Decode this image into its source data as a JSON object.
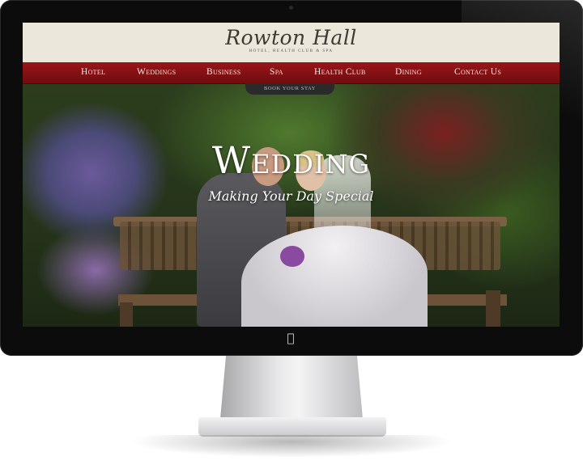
{
  "site": {
    "logo": "Rowton Hall",
    "tagline": "Hotel, Health Club & Spa"
  },
  "nav": {
    "items": [
      {
        "label": "Hotel"
      },
      {
        "label": "Weddings"
      },
      {
        "label": "Business"
      },
      {
        "label": "Spa"
      },
      {
        "label": "Health Club"
      },
      {
        "label": "Dining"
      },
      {
        "label": "Contact Us"
      }
    ],
    "book_label": "Book your stay"
  },
  "hero": {
    "title": "Wedding",
    "subtitle": "Making Your Day Special"
  },
  "colors": {
    "nav_red": "#8a1114",
    "header_cream": "#ebe7da",
    "bezel": "#0c0c0c"
  },
  "icons": {
    "monitor_logo": "apple-logo-icon"
  }
}
